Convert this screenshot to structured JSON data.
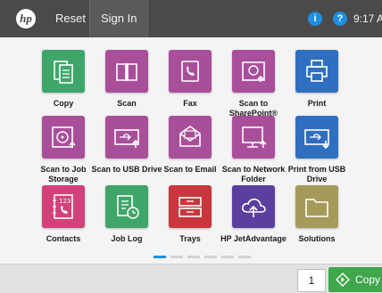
{
  "topbar": {
    "logo_text": "hp",
    "reset_label": "Reset",
    "signin_label": "Sign In",
    "info_glyph": "i",
    "help_glyph": "?",
    "time": "9:17 A"
  },
  "apps": [
    {
      "label": "Copy",
      "color": "#3fa66a",
      "icon": "copy-icon"
    },
    {
      "label": "Scan",
      "color": "#a94f9a",
      "icon": "scan-icon"
    },
    {
      "label": "Fax",
      "color": "#a94f9a",
      "icon": "fax-icon"
    },
    {
      "label": "Scan to SharePoint®",
      "color": "#a94f9a",
      "icon": "scan-to-sharepoint-icon"
    },
    {
      "label": "Print",
      "color": "#2f6fc0",
      "icon": "print-icon"
    },
    {
      "label": "Scan to Job Storage",
      "color": "#a94f9a",
      "icon": "job-storage-icon"
    },
    {
      "label": "Scan to USB Drive",
      "color": "#a94f9a",
      "icon": "usb-drive-icon"
    },
    {
      "label": "Scan to Email",
      "color": "#a94f9a",
      "icon": "email-icon"
    },
    {
      "label": "Scan to Network Folder",
      "color": "#a94f9a",
      "icon": "network-folder-icon"
    },
    {
      "label": "Print from USB Drive",
      "color": "#2f6fc0",
      "icon": "usb-print-icon"
    },
    {
      "label": "Contacts",
      "color": "#d2417a",
      "icon": "contacts-icon"
    },
    {
      "label": "Job Log",
      "color": "#3fa66a",
      "icon": "job-log-icon"
    },
    {
      "label": "Trays",
      "color": "#c8373c",
      "icon": "trays-icon"
    },
    {
      "label": "HP JetAdvantage",
      "color": "#5a3f9e",
      "icon": "cloud-upload-icon"
    },
    {
      "label": "Solutions",
      "color": "#a69a5a",
      "icon": "folder-icon"
    }
  ],
  "pager": {
    "pages": 6,
    "current": 1
  },
  "bottombar": {
    "copies_value": "1",
    "copy_button_label": "Copy"
  }
}
